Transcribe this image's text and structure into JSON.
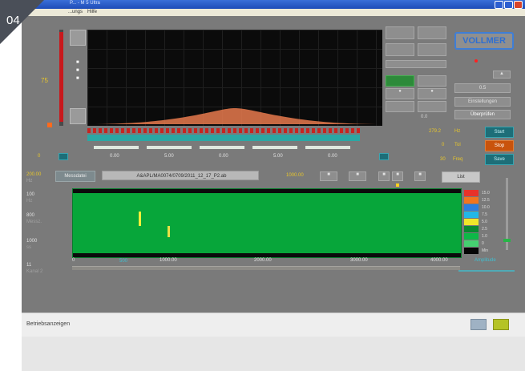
{
  "badge": "04",
  "window": {
    "title": "P... - M 5 Ultra",
    "menu": [
      "...ungs",
      "Hilfe"
    ]
  },
  "logo": "VOLLMER",
  "scope": {
    "left_value": "75",
    "right_value": "0",
    "bottom_left_value": "0",
    "bottom_right_value": "0",
    "scale_labels": [
      "0.00",
      "5.00",
      "0.00",
      "5.00",
      "0.00"
    ]
  },
  "right_panel": {
    "reading_value": "0.0",
    "button_e": "0.5",
    "button_setup": "Einstellungen",
    "button_check": "Überprüfen",
    "field_a_value": "279.2",
    "field_a_unit": "Hz",
    "field_b_value": "0",
    "field_b_unit": "Tol",
    "field_c_value": "30",
    "field_c_unit": "Freq",
    "btn_teal_1": "Start",
    "btn_orange": "Stop",
    "btn_teal_2": "Save"
  },
  "toolbar": {
    "left_label": "200.00",
    "left_sub": "Hz",
    "measure_label": "Messdatei",
    "file_name": "A&APL/MA0074/0709/2011_12_17_P2.ab",
    "position_value": "1000.00",
    "list_button": "List"
  },
  "left_axis": [
    {
      "v": "100",
      "s": "Hz"
    },
    {
      "v": "800",
      "s": "Messz."
    },
    {
      "v": "1000",
      "s": "ss"
    },
    {
      "v": "11",
      "s": "Kanal 2"
    }
  ],
  "spectrogram": {
    "x_ticks": [
      "0",
      "1000.00",
      "2000.00",
      "3000.00",
      "4000.00"
    ],
    "x_mark": "500",
    "right_caption": "Amplitude"
  },
  "legend": [
    {
      "color": "#e8322a",
      "label": "15.0"
    },
    {
      "color": "#f2751e",
      "label": "12.5"
    },
    {
      "color": "#2b7ee0",
      "label": "10.0"
    },
    {
      "color": "#22b7e6",
      "label": "7.5"
    },
    {
      "color": "#f0e62a",
      "label": "5.0"
    },
    {
      "color": "#0a8a32",
      "label": "2.5"
    },
    {
      "color": "#0db847",
      "label": "1.0"
    },
    {
      "color": "#45d070",
      "label": "0"
    },
    {
      "color": "#050505",
      "label": "Min"
    }
  ],
  "status_text": "Betriebsanzeigen"
}
